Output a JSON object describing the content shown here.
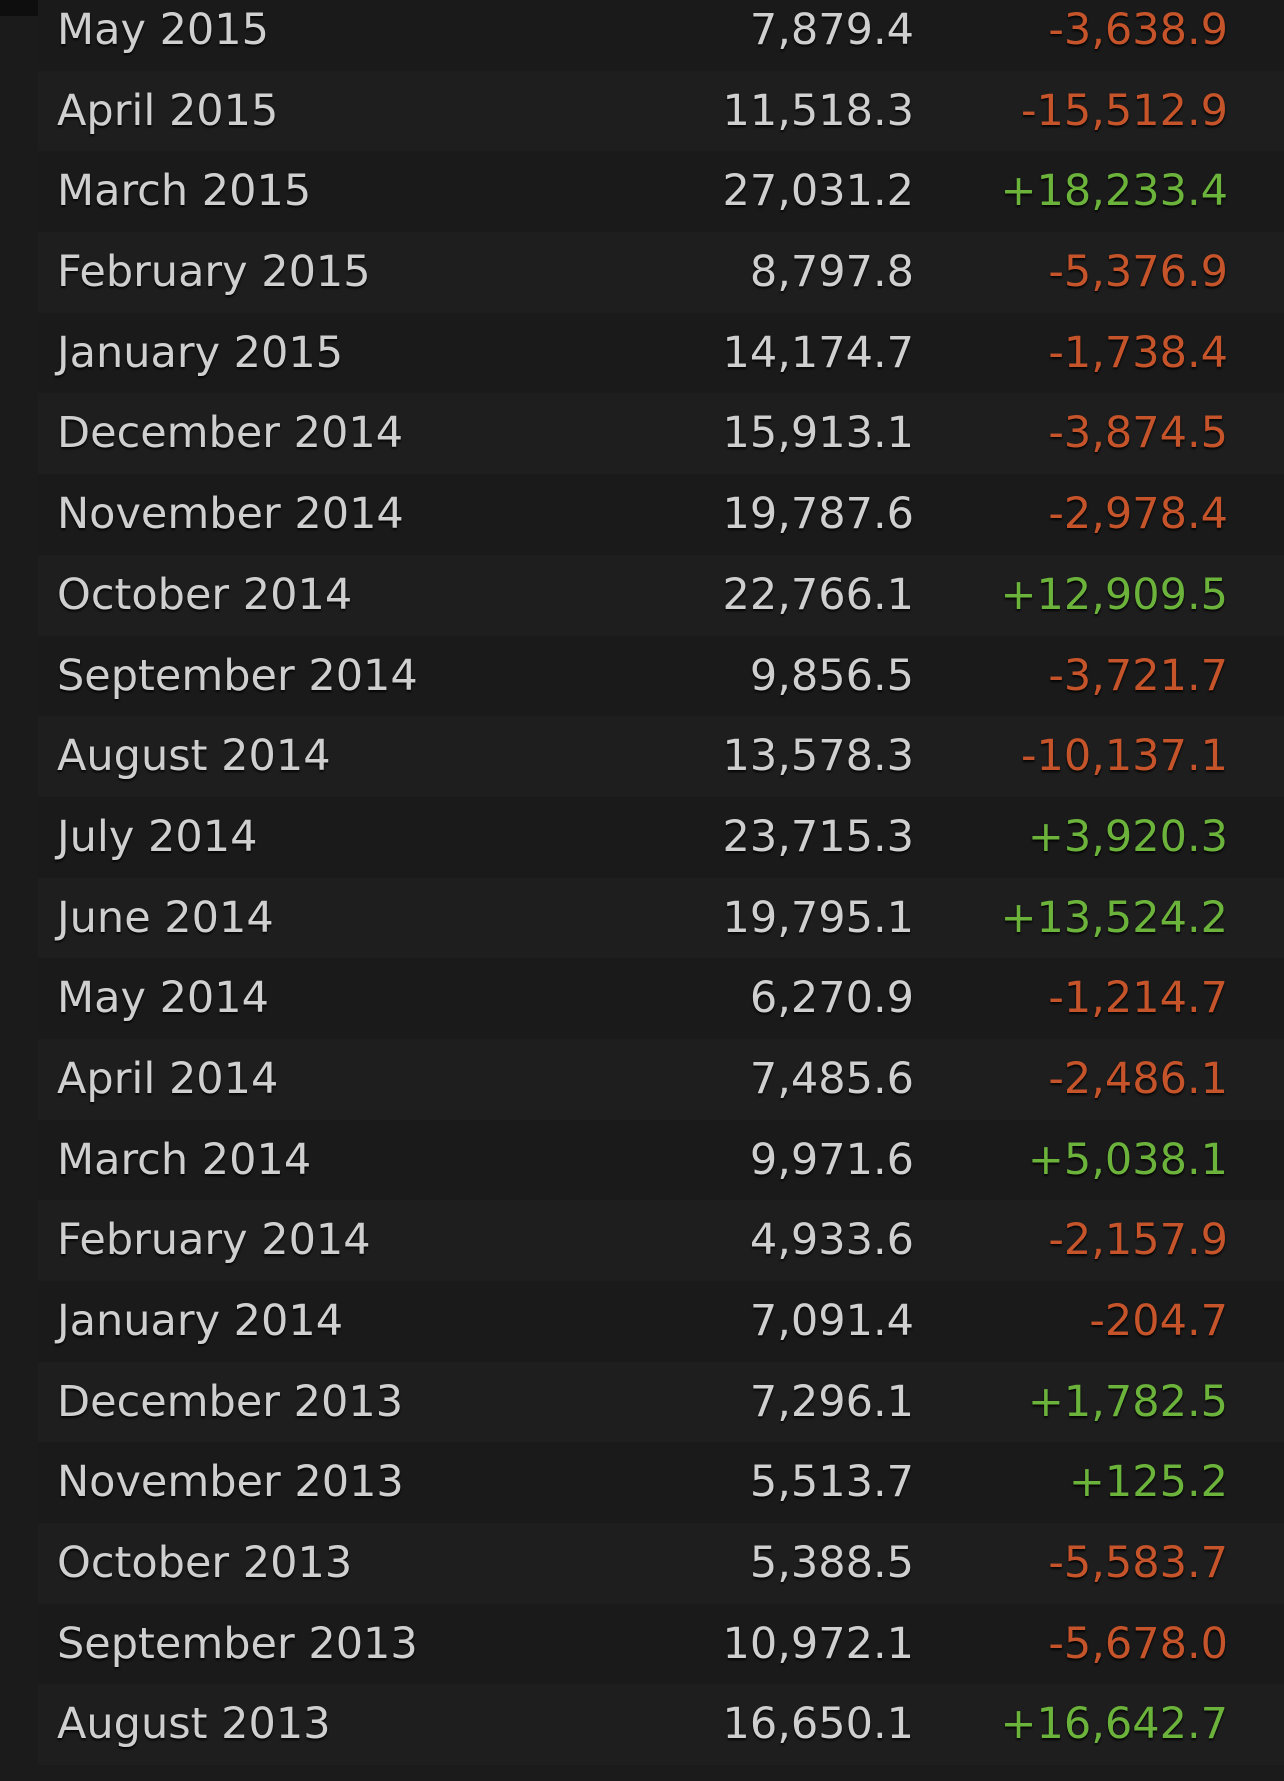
{
  "colors": {
    "negative": "#c6542a",
    "positive": "#6cb33c",
    "text": "#cfcfcf",
    "background": "#1b1b1b"
  },
  "rows": [
    {
      "month": "May 2015",
      "value": "7,879.4",
      "change": "-3,638.9",
      "sign": "neg"
    },
    {
      "month": "April 2015",
      "value": "11,518.3",
      "change": "-15,512.9",
      "sign": "neg"
    },
    {
      "month": "March 2015",
      "value": "27,031.2",
      "change": "+18,233.4",
      "sign": "pos"
    },
    {
      "month": "February 2015",
      "value": "8,797.8",
      "change": "-5,376.9",
      "sign": "neg"
    },
    {
      "month": "January 2015",
      "value": "14,174.7",
      "change": "-1,738.4",
      "sign": "neg"
    },
    {
      "month": "December 2014",
      "value": "15,913.1",
      "change": "-3,874.5",
      "sign": "neg"
    },
    {
      "month": "November 2014",
      "value": "19,787.6",
      "change": "-2,978.4",
      "sign": "neg"
    },
    {
      "month": "October 2014",
      "value": "22,766.1",
      "change": "+12,909.5",
      "sign": "pos"
    },
    {
      "month": "September 2014",
      "value": "9,856.5",
      "change": "-3,721.7",
      "sign": "neg"
    },
    {
      "month": "August 2014",
      "value": "13,578.3",
      "change": "-10,137.1",
      "sign": "neg"
    },
    {
      "month": "July 2014",
      "value": "23,715.3",
      "change": "+3,920.3",
      "sign": "pos"
    },
    {
      "month": "June 2014",
      "value": "19,795.1",
      "change": "+13,524.2",
      "sign": "pos"
    },
    {
      "month": "May 2014",
      "value": "6,270.9",
      "change": "-1,214.7",
      "sign": "neg"
    },
    {
      "month": "April 2014",
      "value": "7,485.6",
      "change": "-2,486.1",
      "sign": "neg"
    },
    {
      "month": "March 2014",
      "value": "9,971.6",
      "change": "+5,038.1",
      "sign": "pos"
    },
    {
      "month": "February 2014",
      "value": "4,933.6",
      "change": "-2,157.9",
      "sign": "neg"
    },
    {
      "month": "January 2014",
      "value": "7,091.4",
      "change": "-204.7",
      "sign": "neg"
    },
    {
      "month": "December 2013",
      "value": "7,296.1",
      "change": "+1,782.5",
      "sign": "pos"
    },
    {
      "month": "November 2013",
      "value": "5,513.7",
      "change": "+125.2",
      "sign": "pos"
    },
    {
      "month": "October 2013",
      "value": "5,388.5",
      "change": "-5,583.7",
      "sign": "neg"
    },
    {
      "month": "September 2013",
      "value": "10,972.1",
      "change": "-5,678.0",
      "sign": "neg"
    },
    {
      "month": "August 2013",
      "value": "16,650.1",
      "change": "+16,642.7",
      "sign": "pos"
    }
  ]
}
